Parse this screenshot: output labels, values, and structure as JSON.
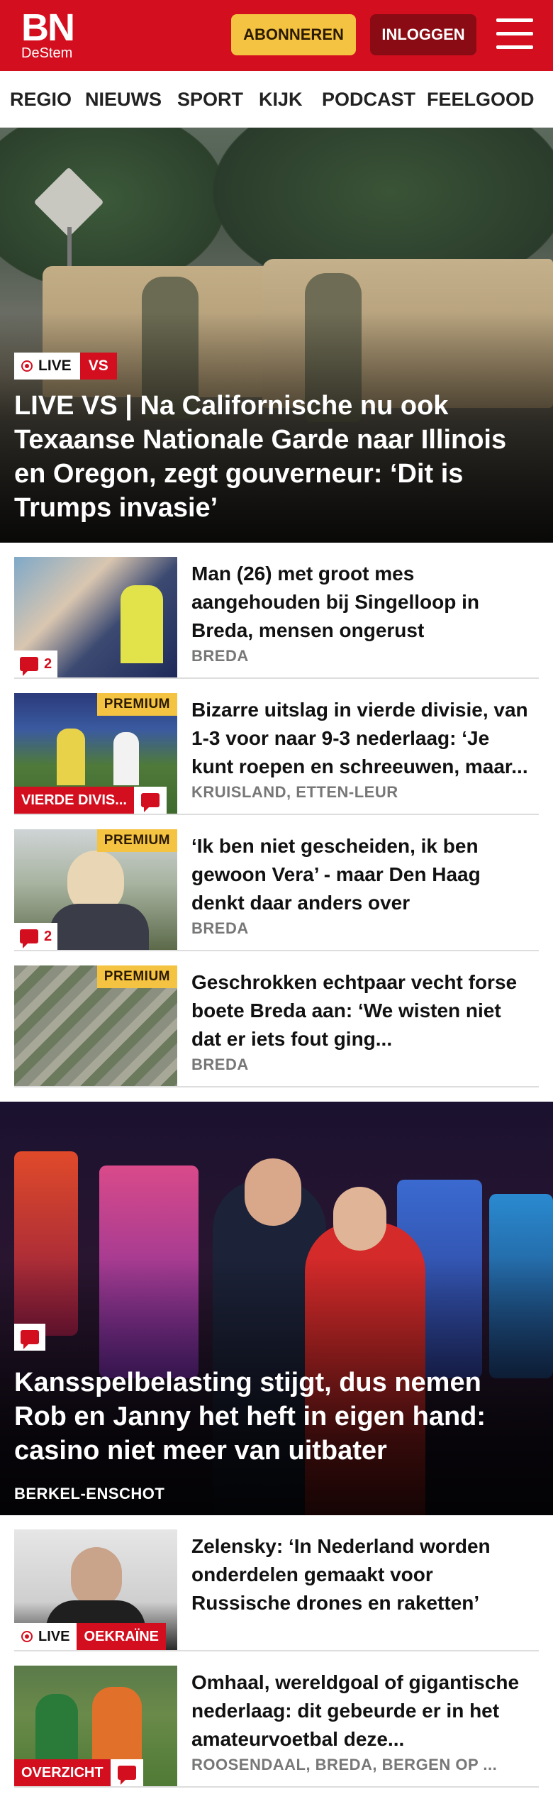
{
  "header": {
    "logo_main": "BN",
    "logo_sub": "DeStem",
    "subscribe_label": "ABONNEREN",
    "login_label": "INLOGGEN",
    "brand_color": "#d30f1f",
    "menu_icon": "hamburger-menu-icon"
  },
  "nav": {
    "items": [
      "REGIO",
      "NIEUWS",
      "SPORT",
      "KIJK",
      "PODCAST",
      "FEELGOOD"
    ]
  },
  "hero": {
    "live_label": "LIVE",
    "section": "VS",
    "title": "LIVE VS | Na Californische nu ook Texaanse Nationale Garde naar Illinois en Oregon, zegt gouverneur: ‘Dit is Trumps invasie’"
  },
  "articles": [
    {
      "title": "Man (26) met groot mes aangehouden bij Singelloop in Breda, mensen ongerust",
      "location": "BREDA",
      "comments": "2"
    },
    {
      "title": "Bizarre uitslag in vierde divisie, van 1-3 voor naar 9-3 nederlaag: ‘Je kunt roepen en schreeuwen, maar...",
      "location": "KRUISLAND, ETTEN-LEUR",
      "premium": "PREMIUM",
      "tag": "VIERDE DIVIS..."
    },
    {
      "title": "‘Ik ben niet gescheiden, ik ben gewoon Vera’ - maar Den Haag denkt daar anders over",
      "location": "BREDA",
      "premium": "PREMIUM",
      "comments": "2"
    },
    {
      "title": "Geschrokken echtpaar vecht forse boete Breda aan: ‘We wisten niet dat er iets fout ging...",
      "location": "BREDA",
      "premium": "PREMIUM"
    }
  ],
  "feature": {
    "title": "Kansspelbelasting stijgt, dus nemen Rob en Janny het heft in eigen hand: casino niet meer van uitbater",
    "location": "BERKEL-ENSCHOT"
  },
  "articles2": [
    {
      "title": "Zelensky: ‘In Nederland worden onderdelen gemaakt voor Russische drones en raketten’",
      "live_label": "LIVE",
      "tag": "OEKRAÏNE"
    },
    {
      "title": "Omhaal, wereldgoal of giganti­sche nederlaag: dit gebeurde er in het amateurvoetbal deze...",
      "location": "ROOSENDAAL, BREDA, BERGEN OP ...",
      "tag": "OVERZICHT"
    }
  ]
}
